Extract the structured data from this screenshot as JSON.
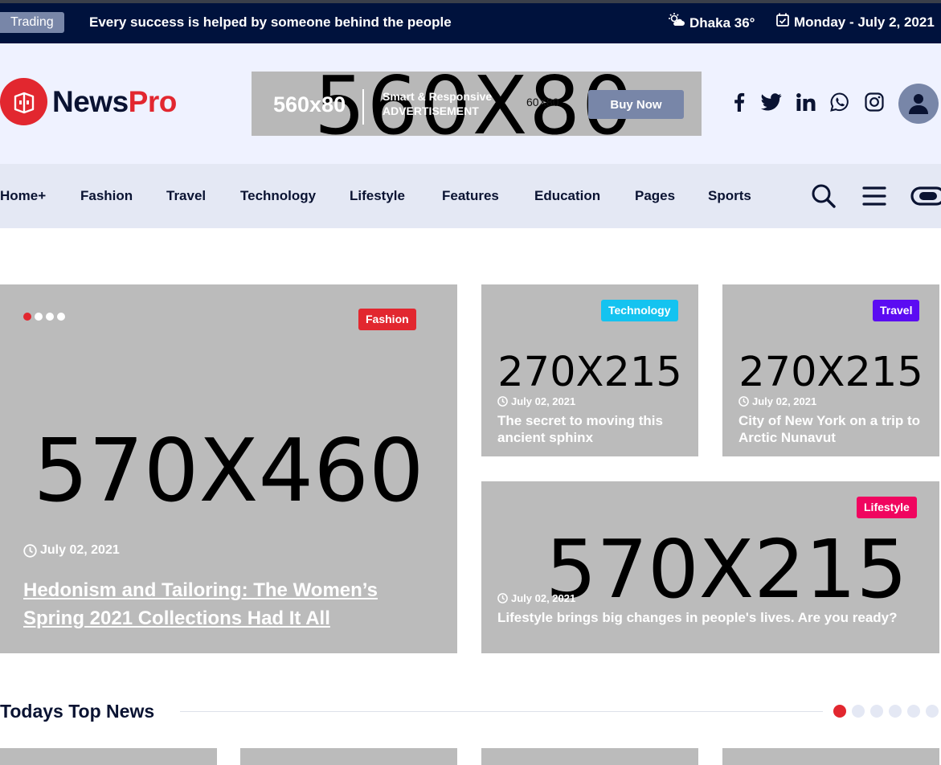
{
  "topbar": {
    "trading_label": "Trading",
    "ticker": "Every success is helped by someone behind the people",
    "weather": "Dhaka 36°",
    "date": "Monday - July 2, 2021",
    "weather_icon": "weather-icon",
    "calendar_icon": "calendar-icon"
  },
  "header": {
    "logo_part1": "News",
    "logo_part2": "Pro",
    "ad": {
      "placeholder": "560X80",
      "size_label": "560x80",
      "smart_line1": "Smart & Responsive",
      "smart_line2": "ADVERTISEMENT",
      "small_label": "60X80",
      "buy_label": "Buy Now"
    },
    "social": [
      "facebook-icon",
      "twitter-icon",
      "linkedin-icon",
      "whatsapp-icon",
      "instagram-icon"
    ]
  },
  "nav": {
    "items": [
      "Home+",
      "Fashion",
      "Travel",
      "Technology",
      "Lifestyle",
      "Features",
      "Education",
      "Pages",
      "Sports"
    ],
    "icons": [
      "search-icon",
      "menu-icon",
      "theme-toggle-icon"
    ]
  },
  "featured": {
    "placeholder": "570X460",
    "category": "Fashion",
    "date": "July 02, 2021",
    "title": "Hedonism and Tailoring: The Women’s Spring 2021 Collections Had It All"
  },
  "side_cards": [
    {
      "placeholder": "270X215",
      "category": "Technology",
      "date": "July 02, 2021",
      "title": "The secret to moving this ancient sphinx"
    },
    {
      "placeholder": "270X215",
      "category": "Travel",
      "date": "July 02, 2021",
      "title": "City of New York on a trip to Arctic Nunavut"
    },
    {
      "placeholder": "570X215",
      "category": "Lifestyle",
      "date": "July 02, 2021",
      "title": "Lifestyle brings big changes in people's lives. Are you ready?"
    }
  ],
  "colors": {
    "accent": "#e2272f",
    "navy": "#00123d",
    "technology": "#14c3f0",
    "travel": "#5b0cf2",
    "lifestyle": "#f0055f"
  },
  "top_news": {
    "title": "Todays Top News"
  }
}
